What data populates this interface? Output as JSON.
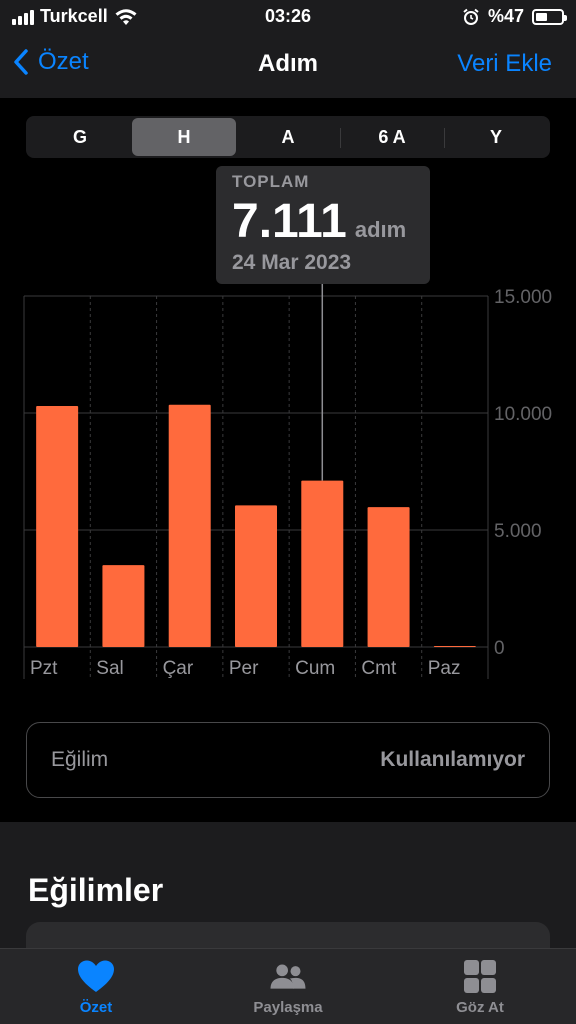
{
  "status_bar": {
    "carrier": "Turkcell",
    "time": "03:26",
    "battery": "%47",
    "battery_level": 0.47
  },
  "nav": {
    "back_label": "Özet",
    "title": "Adım",
    "action_label": "Veri Ekle"
  },
  "segments": {
    "items": [
      "G",
      "H",
      "A",
      "6 A",
      "Y"
    ],
    "selected": "H"
  },
  "tooltip": {
    "label": "TOPLAM",
    "value": "7.111",
    "unit": "adım",
    "date": "24 Mar 2023"
  },
  "chart_data": {
    "type": "bar",
    "categories": [
      "Pzt",
      "Sal",
      "Çar",
      "Per",
      "Cum",
      "Cmt",
      "Paz"
    ],
    "values": [
      10300,
      3500,
      10350,
      6050,
      7111,
      5980,
      0
    ],
    "ylim": [
      0,
      15000
    ],
    "yticks": [
      "15.000",
      "10.000",
      "5.000",
      "0"
    ],
    "ytick_values": [
      15000,
      10000,
      5000,
      0
    ],
    "selected_index": 4,
    "bar_color": "#ff6a3d",
    "grid": true
  },
  "trend": {
    "label": "Eğilim",
    "value": "Kullanılamıyor"
  },
  "section": {
    "title": "Eğilimler"
  },
  "tabbar": {
    "items": [
      {
        "label": "Özet",
        "icon": "heart-icon",
        "active": true
      },
      {
        "label": "Paylaşma",
        "icon": "people-icon",
        "active": false
      },
      {
        "label": "Göz At",
        "icon": "grid-icon",
        "active": false
      }
    ]
  },
  "colors": {
    "accent": "#0a84ff",
    "bar": "#ff6a3d"
  }
}
